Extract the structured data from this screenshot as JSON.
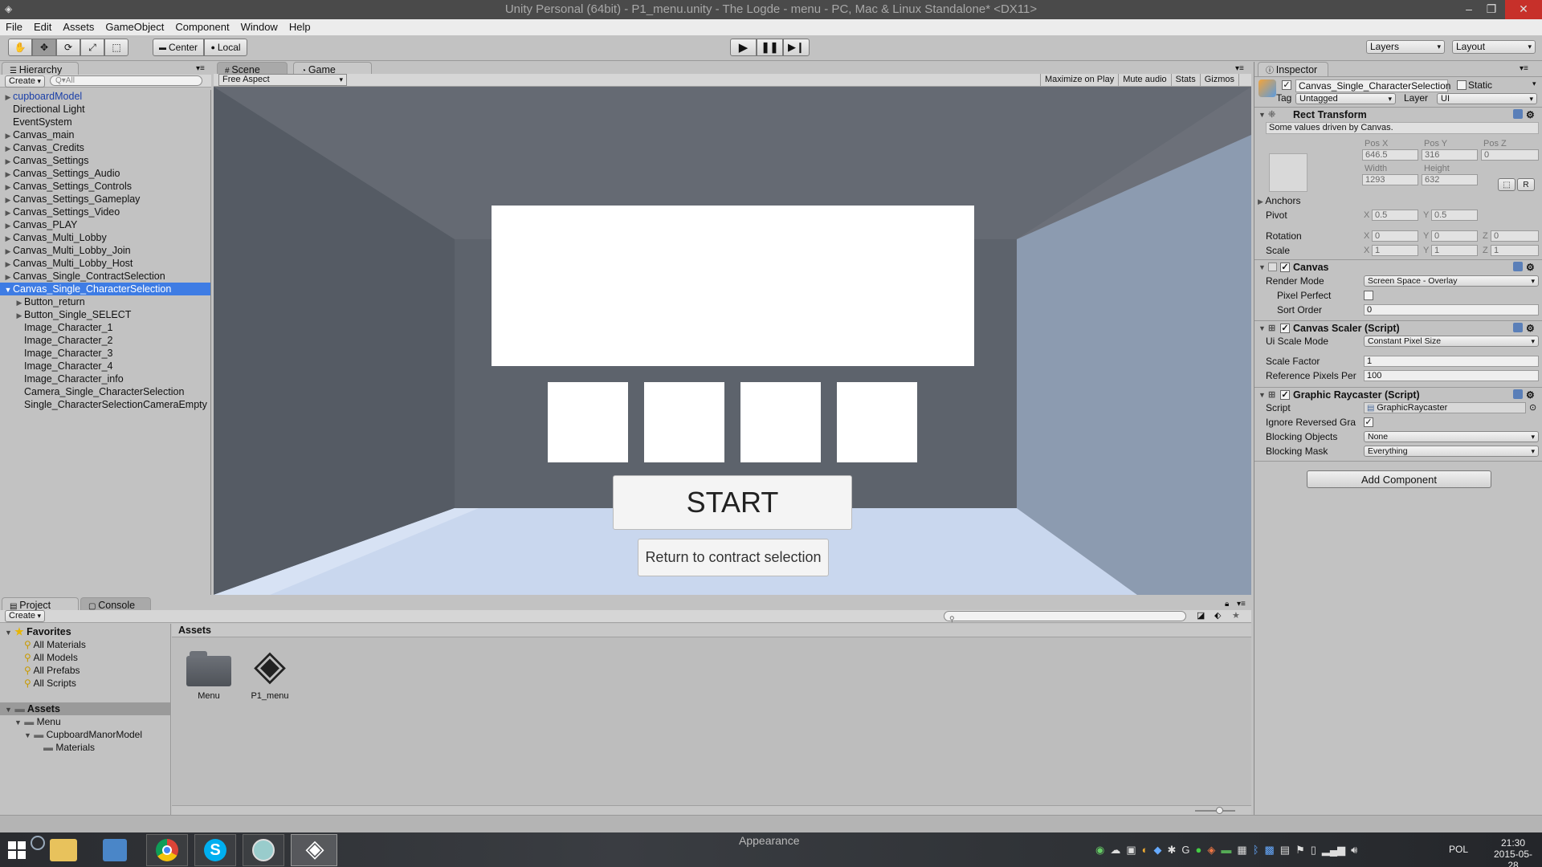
{
  "window": {
    "title": "Unity Personal (64bit) - P1_menu.unity - The Logde - menu - PC, Mac & Linux Standalone* <DX11>",
    "min": "–",
    "max": "❐",
    "close": "✕"
  },
  "menu": [
    "File",
    "Edit",
    "Assets",
    "GameObject",
    "Component",
    "Window",
    "Help"
  ],
  "toolbar": {
    "pivot": "Center",
    "space": "Local",
    "layers": "Layers",
    "layout": "Layout"
  },
  "hierarchy": {
    "tab": "Hierarchy",
    "create": "Create",
    "search_placeholder": "Q▾All",
    "items": [
      {
        "label": "cupboardModel",
        "depth": 0,
        "arrow": "▶",
        "blue": true
      },
      {
        "label": "Directional Light",
        "depth": 0,
        "arrow": ""
      },
      {
        "label": "EventSystem",
        "depth": 0,
        "arrow": ""
      },
      {
        "label": "Canvas_main",
        "depth": 0,
        "arrow": "▶"
      },
      {
        "label": "Canvas_Credits",
        "depth": 0,
        "arrow": "▶"
      },
      {
        "label": "Canvas_Settings",
        "depth": 0,
        "arrow": "▶"
      },
      {
        "label": "Canvas_Settings_Audio",
        "depth": 0,
        "arrow": "▶"
      },
      {
        "label": "Canvas_Settings_Controls",
        "depth": 0,
        "arrow": "▶"
      },
      {
        "label": "Canvas_Settings_Gameplay",
        "depth": 0,
        "arrow": "▶"
      },
      {
        "label": "Canvas_Settings_Video",
        "depth": 0,
        "arrow": "▶"
      },
      {
        "label": "Canvas_PLAY",
        "depth": 0,
        "arrow": "▶"
      },
      {
        "label": "Canvas_Multi_Lobby",
        "depth": 0,
        "arrow": "▶"
      },
      {
        "label": "Canvas_Multi_Lobby_Join",
        "depth": 0,
        "arrow": "▶"
      },
      {
        "label": "Canvas_Multi_Lobby_Host",
        "depth": 0,
        "arrow": "▶"
      },
      {
        "label": "Canvas_Single_ContractSelection",
        "depth": 0,
        "arrow": "▶"
      },
      {
        "label": "Canvas_Single_CharacterSelection",
        "depth": 0,
        "arrow": "▼",
        "selected": true
      },
      {
        "label": "Button_return",
        "depth": 1,
        "arrow": "▶"
      },
      {
        "label": "Button_Single_SELECT",
        "depth": 1,
        "arrow": "▶"
      },
      {
        "label": "Image_Character_1",
        "depth": 1,
        "arrow": ""
      },
      {
        "label": "Image_Character_2",
        "depth": 1,
        "arrow": ""
      },
      {
        "label": "Image_Character_3",
        "depth": 1,
        "arrow": ""
      },
      {
        "label": "Image_Character_4",
        "depth": 1,
        "arrow": ""
      },
      {
        "label": "Image_Character_info",
        "depth": 1,
        "arrow": ""
      },
      {
        "label": "Camera_Single_CharacterSelection",
        "depth": 1,
        "arrow": ""
      },
      {
        "label": "Single_CharacterSelectionCameraEmpty",
        "depth": 1,
        "arrow": ""
      }
    ]
  },
  "scene_tabs": {
    "scene": "Scene",
    "game": "Game"
  },
  "game": {
    "aspect": "Free Aspect",
    "buttons": [
      "Maximize on Play",
      "Mute audio",
      "Stats",
      "Gizmos"
    ],
    "start_label": "START",
    "return_label": "Return to contract selection"
  },
  "inspector": {
    "tab": "Inspector",
    "object_name": "Canvas_Single_CharacterSelection",
    "static_label": "Static",
    "tag_label": "Tag",
    "tag_value": "Untagged",
    "layer_label": "Layer",
    "layer_value": "UI",
    "rect": {
      "title": "Rect Transform",
      "note": "Some values driven by Canvas.",
      "posx_label": "Pos X",
      "posy_label": "Pos Y",
      "posz_label": "Pos Z",
      "posx": "646.5",
      "posy": "316",
      "posz": "0",
      "width_label": "Width",
      "height_label": "Height",
      "width": "1293",
      "height": "632",
      "r_btn": "R",
      "anchors": "Anchors",
      "pivot": "Pivot",
      "pivot_x": "0.5",
      "pivot_y": "0.5",
      "rotation": "Rotation",
      "rot_x": "0",
      "rot_y": "0",
      "rot_z": "0",
      "scale": "Scale",
      "scale_x": "1",
      "scale_y": "1",
      "scale_z": "1",
      "x": "X",
      "y": "Y",
      "z": "Z"
    },
    "canvas": {
      "title": "Canvas",
      "render_mode_label": "Render Mode",
      "render_mode": "Screen Space - Overlay",
      "pixel_perfect_label": "Pixel Perfect",
      "sort_order_label": "Sort Order",
      "sort_order": "0"
    },
    "scaler": {
      "title": "Canvas Scaler (Script)",
      "mode_label": "Ui Scale Mode",
      "mode": "Constant Pixel Size",
      "factor_label": "Scale Factor",
      "factor": "1",
      "ref_label": "Reference Pixels Per",
      "ref": "100"
    },
    "raycaster": {
      "title": "Graphic Raycaster (Script)",
      "script_label": "Script",
      "script": "GraphicRaycaster",
      "ignore_label": "Ignore Reversed Gra",
      "blocking_objects_label": "Blocking Objects",
      "blocking_objects": "None",
      "blocking_mask_label": "Blocking Mask",
      "blocking_mask": "Everything"
    },
    "add_component": "Add Component"
  },
  "project": {
    "tab_project": "Project",
    "tab_console": "Console",
    "create": "Create",
    "favorites_label": "Favorites",
    "favorites": [
      "All Materials",
      "All Models",
      "All Prefabs",
      "All Scripts"
    ],
    "assets_label": "Assets",
    "tree": [
      "Menu",
      "CupboardManorModel",
      "Materials"
    ],
    "breadcrumb": "Assets",
    "files": [
      {
        "name": "Menu"
      },
      {
        "name": "P1_menu"
      }
    ]
  },
  "taskbar": {
    "appearance": "Appearance",
    "lang": "POL",
    "time": "21:30",
    "date": "2015-05-28"
  },
  "colors": {
    "selection": "#3e7ce4",
    "unity_bg": "#c2c2c2",
    "close": "#c7302a"
  }
}
